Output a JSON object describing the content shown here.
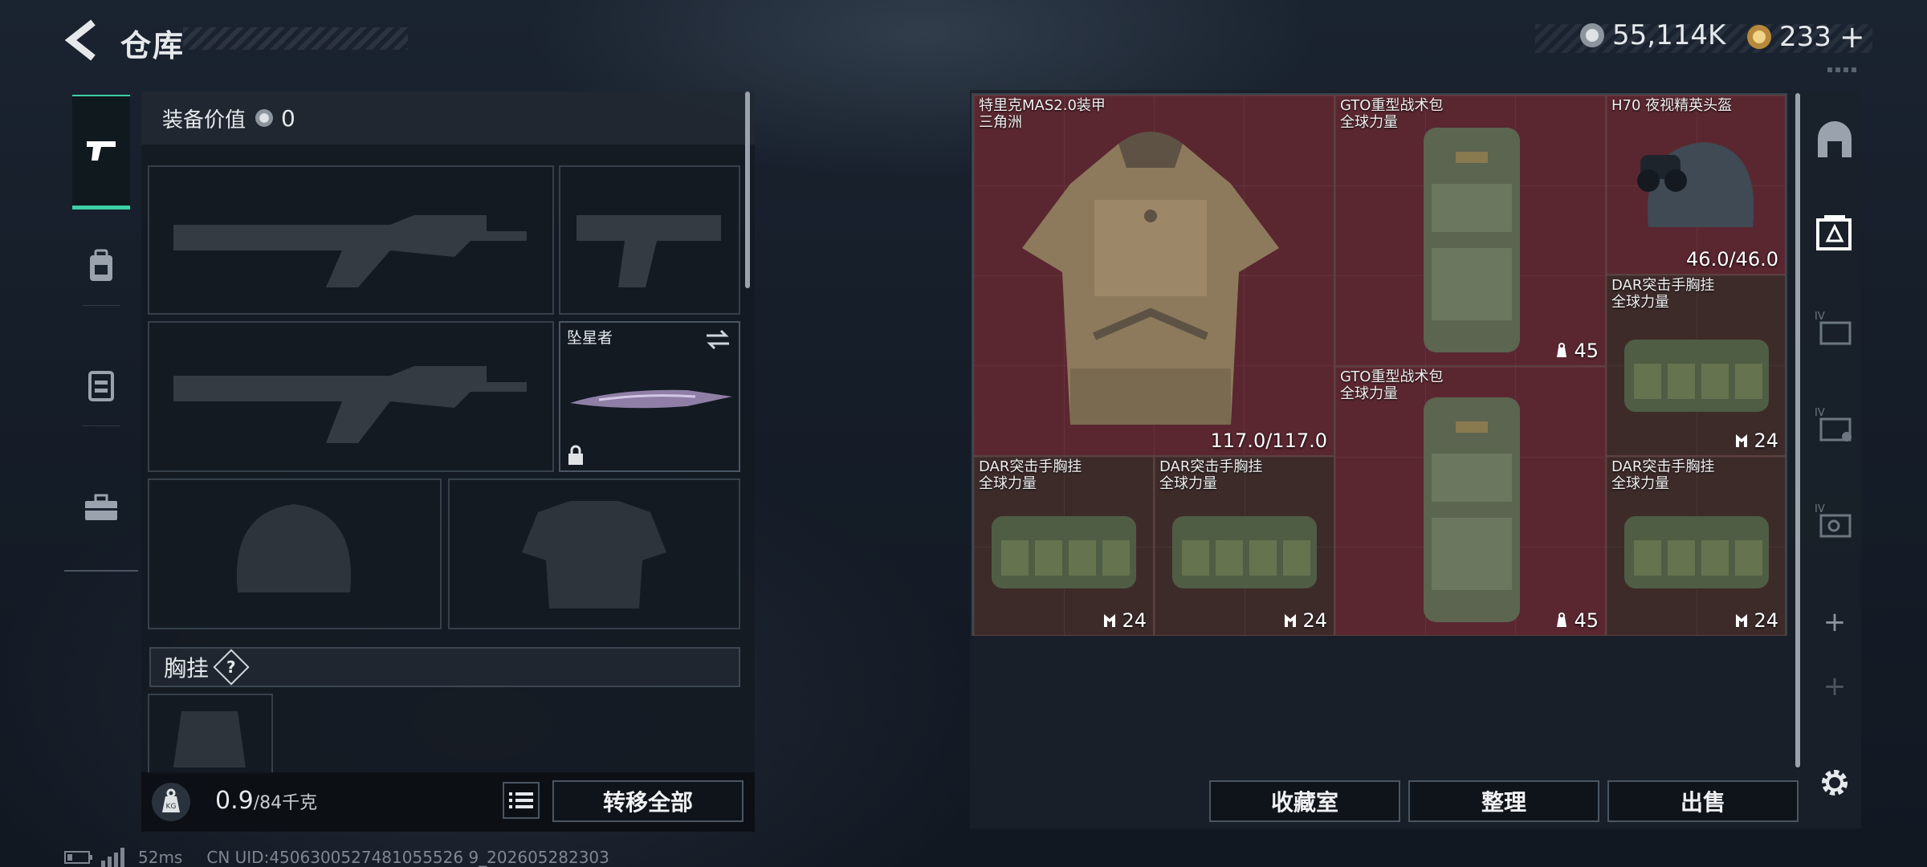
{
  "header": {
    "title": "仓库"
  },
  "currency": {
    "coins": "55,114K",
    "coupons": "233",
    "plus": "+"
  },
  "left_rail": {
    "items": [
      {
        "id": "weapons",
        "icon": "pistol-icon",
        "active": true
      },
      {
        "id": "backpack",
        "icon": "backpack-icon",
        "active": false
      },
      {
        "id": "vest",
        "icon": "vest-icon",
        "active": false
      },
      {
        "id": "toolbox",
        "icon": "briefcase-icon",
        "active": false
      }
    ]
  },
  "equipment": {
    "value_label": "装备价值",
    "value": "0",
    "melee_name": "坠星者",
    "chest_rig_label": "胸挂",
    "help": "?"
  },
  "footer": {
    "weight_current": "0.9",
    "weight_max": "/84千克",
    "transfer_all": "转移全部"
  },
  "stash": {
    "items": [
      {
        "name": "特里克MAS2.0装甲",
        "sub": "三角洲",
        "value": "117.0/117.0",
        "icon": ""
      },
      {
        "name": "GTO重型战术包",
        "sub": "全球力量",
        "value": "45",
        "icon": "weight-icon"
      },
      {
        "name": "H70 夜视精英头盔",
        "sub": "",
        "value": "46.0/46.0",
        "icon": ""
      },
      {
        "name": "DAR突击手胸挂",
        "sub": "全球力量",
        "value": "24",
        "icon": "rig-icon"
      },
      {
        "name": "GTO重型战术包",
        "sub": "全球力量",
        "value": "45",
        "icon": "weight-icon"
      },
      {
        "name": "DAR突击手胸挂",
        "sub": "全球力量",
        "value": "24",
        "icon": "rig-icon"
      },
      {
        "name": "DAR突击手胸挂",
        "sub": "全球力量",
        "value": "24",
        "icon": "rig-icon"
      },
      {
        "name": "DAR突击手胸挂",
        "sub": "全球力量",
        "value": "24",
        "icon": "rig-icon"
      }
    ]
  },
  "actions": {
    "collection": "收藏室",
    "sort": "整理",
    "sell": "出售"
  },
  "right_rail": {
    "tier_label": "IV",
    "plus": "+"
  },
  "status": {
    "ping": "52ms",
    "uid": "CN UID:4506300527481055526 9_202605282303"
  },
  "colors": {
    "accent": "#3ecfa6",
    "cell_red": "#5a2730",
    "cell_brown": "#3d2b2a"
  }
}
